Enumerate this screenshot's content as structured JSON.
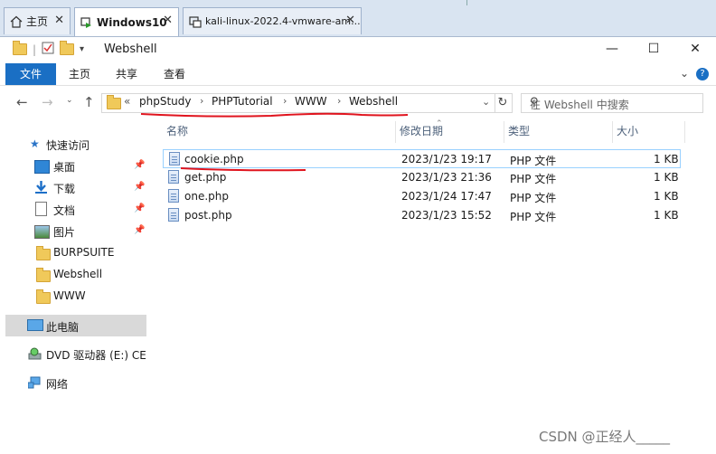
{
  "vm_tabs": [
    {
      "label": "主页",
      "icon": "home-icon"
    },
    {
      "label": "Windows10",
      "icon": "vm-running-icon"
    },
    {
      "label": "kali-linux-2022.4-vmware-am...",
      "icon": "vm-icon"
    }
  ],
  "window": {
    "title": "Webshell"
  },
  "ribbon": {
    "tabs": [
      "文件",
      "主页",
      "共享",
      "查看"
    ],
    "help": "?"
  },
  "address": {
    "overflow": "«",
    "crumbs": [
      "phpStudy",
      "PHPTutorial",
      "WWW",
      "Webshell"
    ],
    "search_placeholder": "在 Webshell 中搜索"
  },
  "sidebar": {
    "quick_access": "快速访问",
    "items": [
      {
        "label": "桌面",
        "icon": "desktop-icon",
        "pinned": true
      },
      {
        "label": "下载",
        "icon": "download-icon",
        "pinned": true
      },
      {
        "label": "文档",
        "icon": "document-icon",
        "pinned": true
      },
      {
        "label": "图片",
        "icon": "picture-icon",
        "pinned": true
      },
      {
        "label": "BURPSUITE",
        "icon": "folder-icon",
        "pinned": false
      },
      {
        "label": "Webshell",
        "icon": "folder-icon",
        "pinned": false
      },
      {
        "label": "WWW",
        "icon": "folder-icon",
        "pinned": false
      }
    ],
    "this_pc": "此电脑",
    "dvd": "DVD 驱动器 (E:) CES",
    "network": "网络"
  },
  "columns": [
    "名称",
    "修改日期",
    "类型",
    "大小"
  ],
  "files": [
    {
      "name": "cookie.php",
      "date": "2023/1/23 19:17",
      "type": "PHP 文件",
      "size": "1 KB"
    },
    {
      "name": "get.php",
      "date": "2023/1/23 21:36",
      "type": "PHP 文件",
      "size": "1 KB"
    },
    {
      "name": "one.php",
      "date": "2023/1/24 17:47",
      "type": "PHP 文件",
      "size": "1 KB"
    },
    {
      "name": "post.php",
      "date": "2023/1/23 15:52",
      "type": "PHP 文件",
      "size": "1 KB"
    }
  ],
  "watermark": "CSDN @正经人_____",
  "colors": {
    "accent": "#1a6fc4",
    "annotation": "#e0141e",
    "selection": "#99d1ff"
  }
}
